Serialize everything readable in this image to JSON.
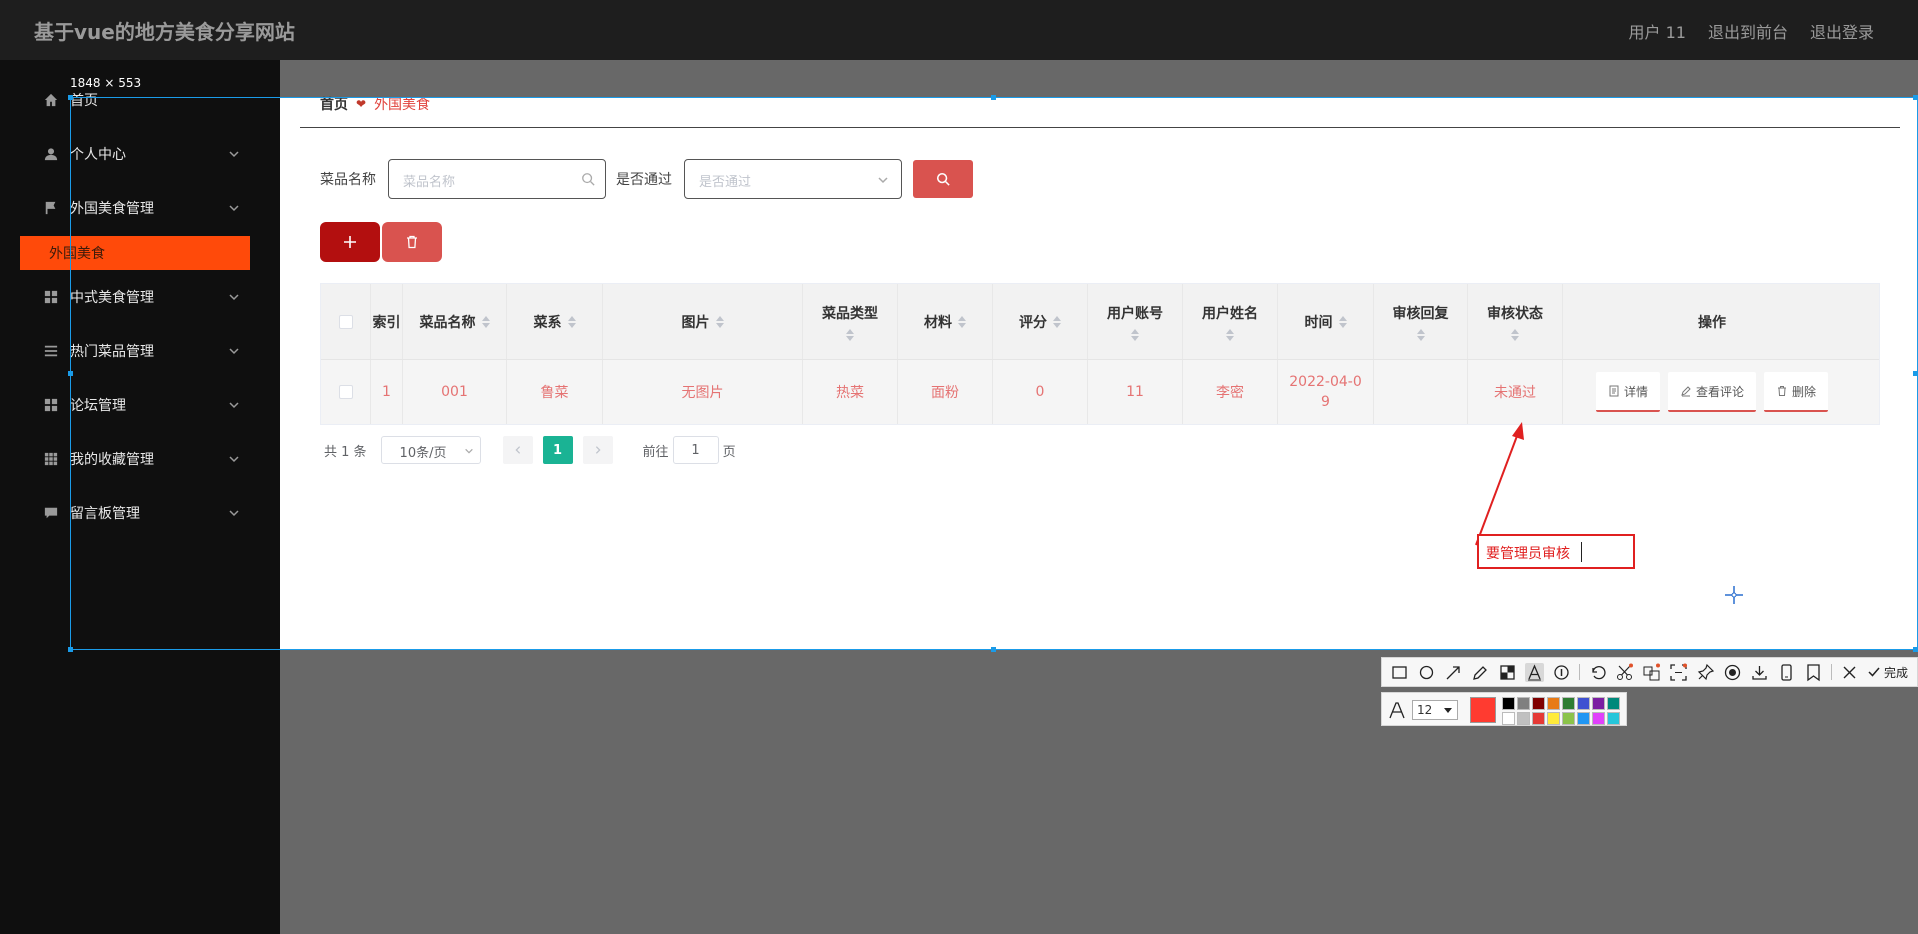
{
  "header": {
    "brand": "基于vue的地方美食分享网站",
    "nav": [
      "用户 11",
      "退出到前台",
      "退出登录"
    ]
  },
  "sidebar": {
    "items": [
      {
        "label": "首页",
        "icon": "home-icon",
        "expandable": false
      },
      {
        "label": "个人中心",
        "icon": "user-icon",
        "expandable": true
      },
      {
        "label": "外国美食管理",
        "icon": "flag-icon",
        "expandable": true
      },
      {
        "label": "中式美食管理",
        "icon": "grid-icon",
        "expandable": true
      },
      {
        "label": "热门菜品管理",
        "icon": "list-icon",
        "expandable": true
      },
      {
        "label": "论坛管理",
        "icon": "grid-icon",
        "expandable": true
      },
      {
        "label": "我的收藏管理",
        "icon": "apps-icon",
        "expandable": true
      },
      {
        "label": "留言板管理",
        "icon": "message-icon",
        "expandable": true
      }
    ],
    "active_sub": "外国美食"
  },
  "breadcrumb": {
    "home": "首页",
    "current": "外国美食"
  },
  "search": {
    "name_label": "菜品名称",
    "name_placeholder": "菜品名称",
    "pass_label": "是否通过",
    "pass_placeholder": "是否通过"
  },
  "table": {
    "headers": [
      "索引",
      "菜品名称",
      "菜系",
      "图片",
      "菜品类型",
      "材料",
      "评分",
      "用户账号",
      "用户姓名",
      "时间",
      "审核回复",
      "审核状态",
      "操作"
    ],
    "rows": [
      {
        "index": "1",
        "name": "001",
        "cuisine": "鲁菜",
        "image": "无图片",
        "type": "热菜",
        "material": "面粉",
        "score": "0",
        "account": "11",
        "username": "李密",
        "time": "2022-04-0\n9",
        "reply": "",
        "status": "未通过"
      }
    ],
    "ops": [
      "详情",
      "查看评论",
      "删除"
    ]
  },
  "pager": {
    "total": "共 1 条",
    "page_size": "10条/页",
    "current_page": "1",
    "goto_prefix": "前往",
    "goto_value": "1",
    "goto_suffix": "页"
  },
  "annotation": {
    "dimensions": "1848 × 553",
    "note": "要管理员审核"
  },
  "toolbar": {
    "done_label": "完成",
    "font_size": "12",
    "current_color": "#ff3b30",
    "swatches": [
      "#000000",
      "#808080",
      "#800000",
      "#e87b16",
      "#2e7d32",
      "#3f51d1",
      "#7b1fa2",
      "#00897b",
      "#ffffff",
      "#c0c0c0",
      "#e53935",
      "#ffeb3b",
      "#8bc34a",
      "#2196f3",
      "#e040fb",
      "#26c6da"
    ]
  }
}
